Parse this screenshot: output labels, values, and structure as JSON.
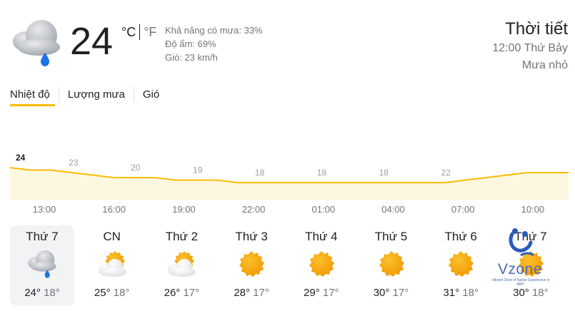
{
  "current": {
    "temp": "24",
    "unit_c": "°C",
    "unit_f": "°F",
    "rain_chance": "Khả năng có mưa: 33%",
    "humidity": "Độ ẩm: 69%",
    "wind": "Gió: 23 km/h",
    "icon": "rain-cloud-icon"
  },
  "summary": {
    "title": "Thời tiết",
    "datetime": "12:00 Thứ Bảy",
    "condition": "Mưa nhỏ"
  },
  "tabs": [
    {
      "label": "Nhiệt độ",
      "active": true
    },
    {
      "label": "Lượng mưa",
      "active": false
    },
    {
      "label": "Gió",
      "active": false
    }
  ],
  "chart_data": {
    "type": "area",
    "series": [
      {
        "values": [
          24,
          23,
          23,
          22,
          21,
          20,
          20,
          20,
          19,
          19,
          19,
          18,
          18,
          18,
          18,
          18,
          18,
          18,
          18,
          18,
          18,
          18,
          19,
          20,
          21,
          22,
          22,
          22
        ]
      }
    ],
    "labels": [
      {
        "index": 0,
        "text": "24"
      },
      {
        "index": 3,
        "text": "23"
      },
      {
        "index": 6,
        "text": "20"
      },
      {
        "index": 9,
        "text": "19"
      },
      {
        "index": 12,
        "text": "18"
      },
      {
        "index": 15,
        "text": "18"
      },
      {
        "index": 18,
        "text": "18"
      },
      {
        "index": 21,
        "text": "22"
      }
    ],
    "x_ticks": [
      "13:00",
      "16:00",
      "19:00",
      "22:00",
      "01:00",
      "04:00",
      "07:00",
      "10:00"
    ],
    "colors": {
      "line": "#fbbc04",
      "fill": "#fef7e0"
    }
  },
  "days": [
    {
      "name": "Thứ 7",
      "icon": "rain-cloud-icon",
      "high": "24°",
      "low": "18°",
      "selected": true
    },
    {
      "name": "CN",
      "icon": "partly-cloudy-icon",
      "high": "25°",
      "low": "18°",
      "selected": false
    },
    {
      "name": "Thứ 2",
      "icon": "partly-cloudy-icon",
      "high": "26°",
      "low": "17°",
      "selected": false
    },
    {
      "name": "Thứ 3",
      "icon": "sun-icon",
      "high": "28°",
      "low": "17°",
      "selected": false
    },
    {
      "name": "Thứ 4",
      "icon": "sun-icon",
      "high": "29°",
      "low": "17°",
      "selected": false
    },
    {
      "name": "Thứ 5",
      "icon": "sun-icon",
      "high": "30°",
      "low": "17°",
      "selected": false
    },
    {
      "name": "Thứ 6",
      "icon": "sun-icon",
      "high": "31°",
      "low": "18°",
      "selected": false
    },
    {
      "name": "Thứ 7",
      "icon": "sun-icon",
      "high": "30°",
      "low": "18°",
      "selected": false
    }
  ],
  "watermark": {
    "text": "Vzone",
    "tagline": "Vibrant Zone of Native Experience in BMT"
  },
  "colors": {
    "accent": "#fbbc04",
    "sun": "#f6a623",
    "raindrop": "#1a73e8"
  }
}
